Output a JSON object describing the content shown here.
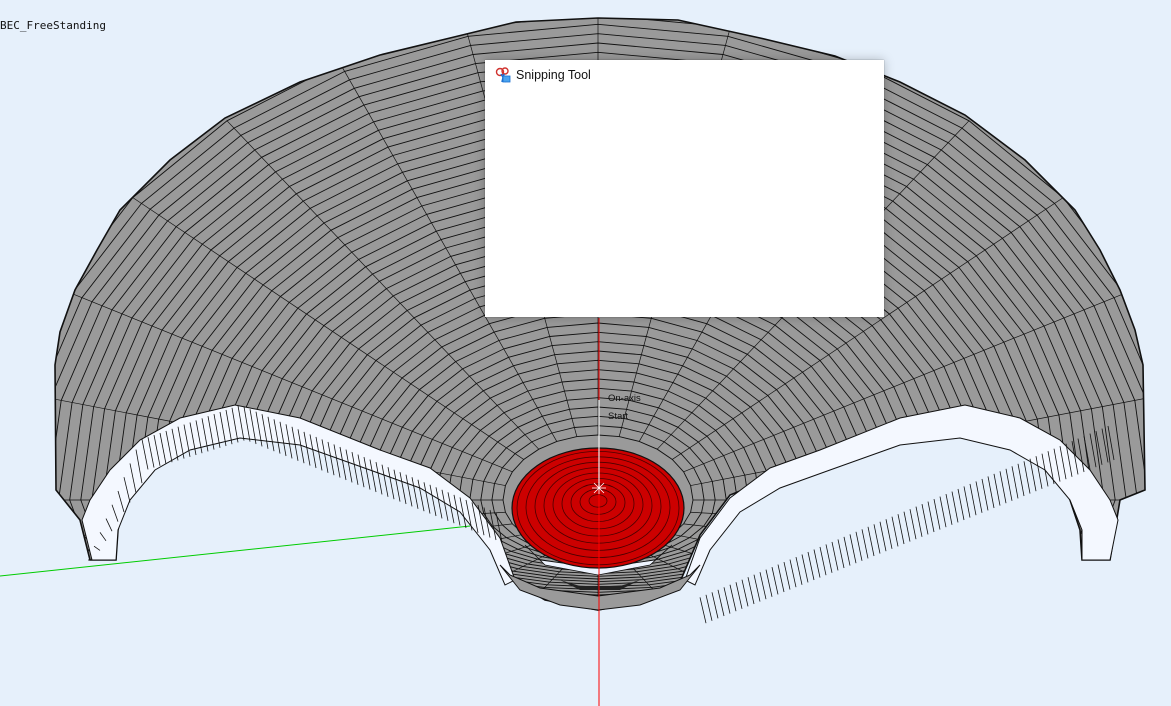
{
  "model_name": "BEC_FreeStanding",
  "markers": {
    "on_axis": "On-axis",
    "start": "Start"
  },
  "snipping_tool": {
    "title": "Snipping Tool",
    "icon": "scissors-icon"
  },
  "colors": {
    "background": "#e6f0fb",
    "horn_fill": "#999999",
    "mesh_line": "#111111",
    "driver_fill": "#cc0000",
    "x_axis": "#00cc00",
    "y_axis": "#ff0000"
  }
}
